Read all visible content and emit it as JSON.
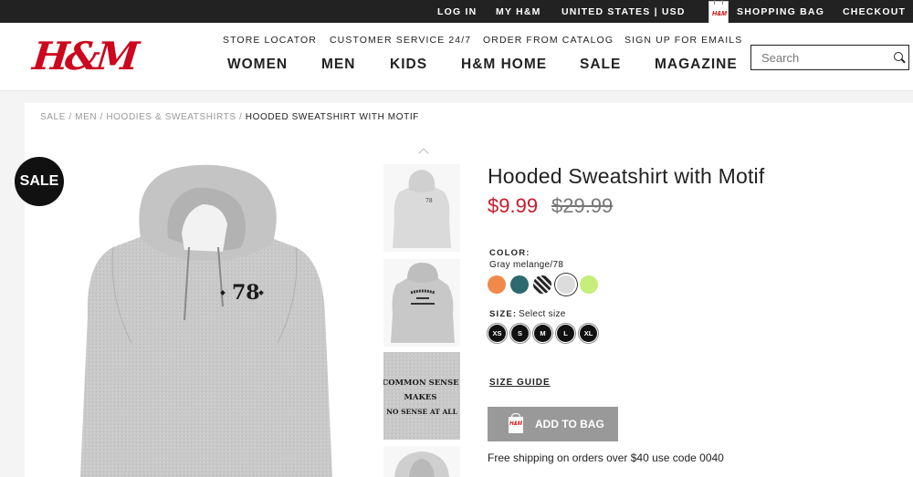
{
  "topbar": {
    "login": "LOG IN",
    "my_hm": "MY H&M",
    "country": "UNITED STATES | USD",
    "bag_logo": "H&M",
    "shopping_bag": "SHOPPING BAG",
    "checkout": "CHECKOUT"
  },
  "header": {
    "logo": "H&M",
    "utility_links": [
      "STORE LOCATOR",
      "CUSTOMER SERVICE 24/7",
      "ORDER FROM CATALOG",
      "SIGN UP FOR EMAILS"
    ],
    "nav": [
      "WOMEN",
      "MEN",
      "KIDS",
      "H&M HOME",
      "SALE",
      "MAGAZINE"
    ],
    "search_placeholder": "Search"
  },
  "breadcrumb": {
    "items": [
      "SALE",
      "MEN",
      "HOODIES & SWEATSHIRTS"
    ],
    "current": "HOODED SWEATSHIRT WITH MOTIF",
    "separator": "/"
  },
  "product": {
    "sale_badge": "SALE",
    "image_print": "78",
    "thumbnail_print": "COMMON SENSE MAKES NO SENSE AT ALL",
    "thumbnail_print_lines": [
      "COMMON SENSE",
      "MAKES",
      "NO SENSE AT ALL"
    ],
    "title": "Hooded Sweatshirt with Motif",
    "price_sale": "$9.99",
    "price_original": "$29.99",
    "color_label": "COLOR:",
    "color_selected": "Gray melange/78",
    "swatches": [
      {
        "name": "orange",
        "color": "#f08a4b"
      },
      {
        "name": "teal",
        "color": "#2b6a6e"
      },
      {
        "name": "black-pattern",
        "color": "#333333"
      },
      {
        "name": "light-gray",
        "color": "#dcdcdc",
        "selected": true
      },
      {
        "name": "lime",
        "color": "#c5ee7a"
      }
    ],
    "size_label": "SIZE:",
    "size_hint": "Select size",
    "sizes": [
      "XS",
      "S",
      "M",
      "L",
      "XL"
    ],
    "size_guide": "SIZE GUIDE",
    "add_to_bag": "ADD TO BAG",
    "add_bag_icon": "H&M",
    "shipping_note": "Free shipping on orders over $40 use code 0040"
  },
  "colors": {
    "brand_red": "#cc071e",
    "sale_price": "#c81b2b",
    "button_gray": "#999999"
  }
}
